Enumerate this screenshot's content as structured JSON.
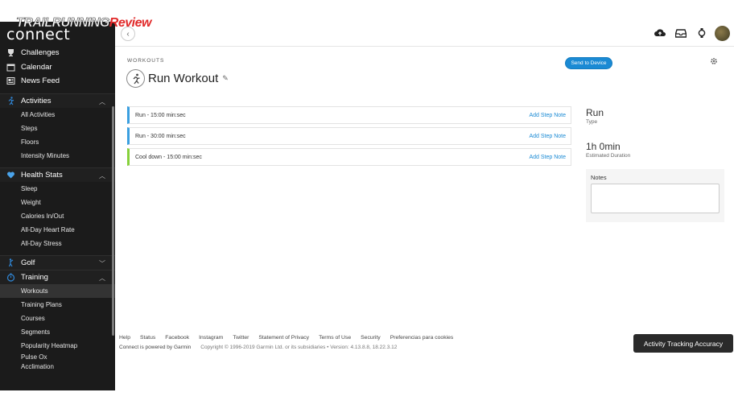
{
  "watermark": {
    "part1": "TRAILRUNNING",
    "part2": "Review"
  },
  "logo": "connect",
  "nav": {
    "challenges": "Challenges",
    "calendar": "Calendar",
    "news_feed": "News Feed",
    "activities": {
      "label": "Activities",
      "items": [
        "All Activities",
        "Steps",
        "Floors",
        "Intensity Minutes"
      ]
    },
    "health": {
      "label": "Health Stats",
      "items": [
        "Sleep",
        "Weight",
        "Calories In/Out",
        "All-Day Heart Rate",
        "All-Day Stress"
      ]
    },
    "golf": {
      "label": "Golf"
    },
    "training": {
      "label": "Training",
      "items": [
        "Workouts",
        "Training Plans",
        "Courses",
        "Segments",
        "Popularity Heatmap"
      ],
      "pulse_line1": "Pulse Ox",
      "pulse_line2": "Acclimation"
    }
  },
  "breadcrumb": "WORKOUTS",
  "send_button": "Send to Device",
  "title": "Run Workout",
  "steps": [
    {
      "label": "Run - 15:00 min:sec",
      "note": "Add Step Note",
      "kind": "run"
    },
    {
      "label": "Run - 30:00 min:sec",
      "note": "Add Step Note",
      "kind": "run"
    },
    {
      "label": "Cool down - 15:00 min:sec",
      "note": "Add Step Note",
      "kind": "cool"
    }
  ],
  "info": {
    "type_value": "Run",
    "type_label": "Type",
    "duration_value": "1h 0min",
    "duration_label": "Estimated Duration"
  },
  "notes_title": "Notes",
  "footer": {
    "links": [
      "Help",
      "Status",
      "Facebook",
      "Instagram",
      "Twitter",
      "Statement of Privacy",
      "Terms of Use",
      "Security",
      "Preferencias para cookies"
    ],
    "powered_prefix": "Connect is powered by",
    "powered_brand": "Garmin",
    "copyright": "Copyright © 1996-2019 Garmin Ltd. or its subsidiaries • Version: 4.13.8.8, 18.22.3.12"
  },
  "accuracy_button": "Activity Tracking Accuracy",
  "colors": {
    "accent_blue": "#1a8ad4",
    "sidebar": "#1b1b1b",
    "run_step": "#3a9fe0",
    "cool_step": "#86d13b"
  }
}
